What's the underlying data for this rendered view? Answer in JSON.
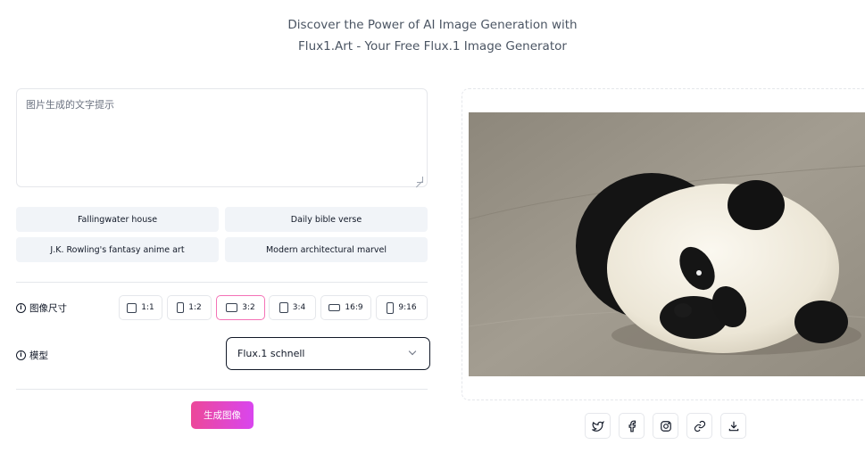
{
  "hero": {
    "line1": "Discover the Power of AI Image Generation with",
    "line2": "Flux1.Art - Your Free Flux.1 Image Generator"
  },
  "prompt": {
    "placeholder": "图片生成的文字提示",
    "value": ""
  },
  "suggestions": [
    "Fallingwater house",
    "Daily bible verse",
    "J.K. Rowling's fantasy anime art",
    "Modern architectural marvel"
  ],
  "size": {
    "label": "图像尺寸",
    "options": [
      "1:1",
      "1:2",
      "3:2",
      "3:4",
      "16:9",
      "9:16"
    ],
    "selected": "3:2"
  },
  "model": {
    "label": "模型",
    "selected": "Flux.1 schnell"
  },
  "generate_label": "生成图像",
  "preview": {
    "subject_icon": "panda-photo"
  },
  "share": {
    "icons": [
      "twitter-icon",
      "facebook-icon",
      "instagram-icon",
      "link-icon",
      "download-icon"
    ]
  },
  "colors": {
    "accent_pink": "#ec4899",
    "accent_violet": "#d946ef",
    "chip_bg": "#f1f4f8",
    "border": "#e5e7eb"
  }
}
